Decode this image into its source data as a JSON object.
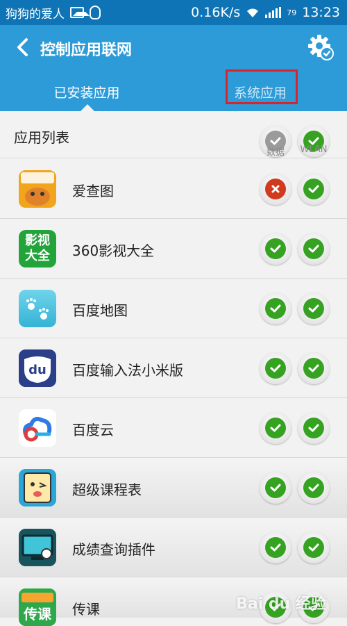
{
  "status_bar": {
    "carrier": "狗狗的爱人",
    "net_speed": "0.16K/s",
    "battery": "79",
    "time": "13:23"
  },
  "header": {
    "title": "控制应用联网",
    "back_icon": "chevron-left-icon",
    "settings_icon": "gear-check-icon"
  },
  "tabs": [
    {
      "label": "已安装应用",
      "selected": true
    },
    {
      "label": "系统应用",
      "selected": false
    }
  ],
  "list_header": {
    "label": "应用列表",
    "col_data": "数据",
    "col_wlan": "WLAN"
  },
  "apps": [
    {
      "name": "爱查图",
      "data": "blocked",
      "wlan": "allowed"
    },
    {
      "name": "360影视大全",
      "data": "allowed",
      "wlan": "allowed",
      "icon_text": "影视\n大全"
    },
    {
      "name": "百度地图",
      "data": "allowed",
      "wlan": "allowed"
    },
    {
      "name": "百度输入法小米版",
      "data": "allowed",
      "wlan": "allowed",
      "icon_text": "du"
    },
    {
      "name": "百度云",
      "data": "allowed",
      "wlan": "allowed"
    },
    {
      "name": "超级课程表",
      "data": "allowed",
      "wlan": "allowed"
    },
    {
      "name": "成绩查询插件",
      "data": "allowed",
      "wlan": "allowed"
    },
    {
      "name": "传课",
      "data": "allowed",
      "wlan": "allowed"
    }
  ],
  "watermark": "Bai du 经验",
  "colors": {
    "status_bar": "#0f74b6",
    "app_bar": "#2d9bd8",
    "check_green": "#36a222",
    "cross_red": "#d23a1e",
    "highlight_box": "#d7242b"
  }
}
